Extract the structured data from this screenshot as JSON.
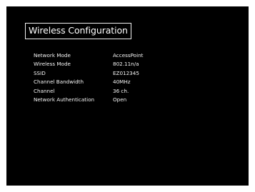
{
  "panel": {
    "title": "Wireless Configuration"
  },
  "settings": [
    {
      "label": "Network Mode",
      "value": "AccessPoint"
    },
    {
      "label": "Wireless Mode",
      "value": "802.11n/a"
    },
    {
      "label": "SSID",
      "value": "EZ012345"
    },
    {
      "label": "Channel Bandwidth",
      "value": "40MHz"
    },
    {
      "label": "Channel",
      "value": "36 ch."
    },
    {
      "label": "Network Authentication",
      "value": "Open"
    }
  ],
  "colors": {
    "background": "#000000",
    "text": "#ffffff",
    "border": "#ffffff",
    "frame": "#ffffff"
  }
}
